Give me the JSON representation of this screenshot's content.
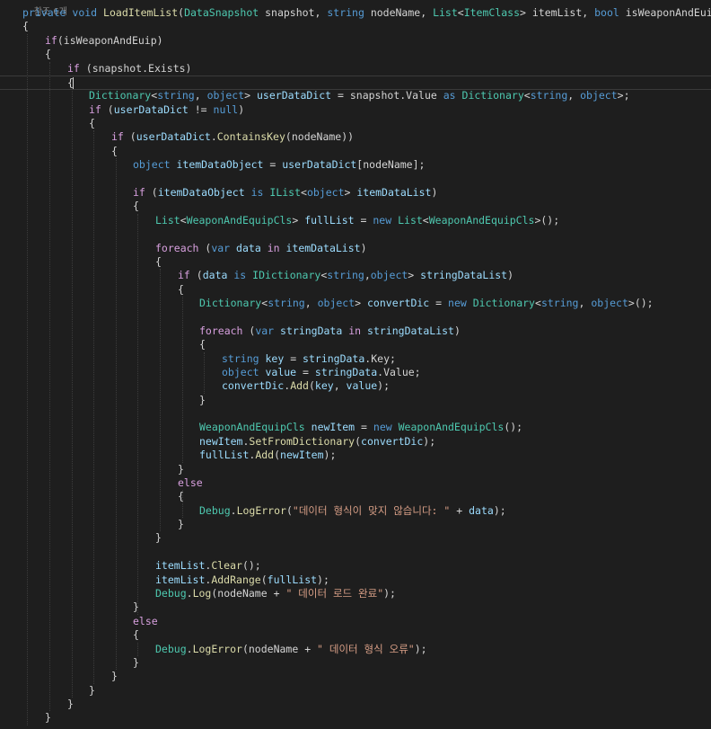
{
  "editor": {
    "language": "C#",
    "theme_colors": {
      "background": "#1e1e1e",
      "keyword": "#569cd6",
      "control": "#d8a0df",
      "type": "#4ec9b0",
      "method": "#dcdcaa",
      "variable": "#9cdcfe",
      "string": "#d69d85",
      "text": "#d4d4d4"
    },
    "codelens": "참조 6개",
    "lines": [
      [
        {
          "k": "kw",
          "t": "private"
        },
        {
          "k": "pun",
          "t": " "
        },
        {
          "k": "kw",
          "t": "void"
        },
        {
          "k": "pun",
          "t": " "
        },
        {
          "k": "method",
          "t": "LoadItemList"
        },
        {
          "k": "pun",
          "t": "("
        },
        {
          "k": "type",
          "t": "DataSnapshot"
        },
        {
          "k": "pun",
          "t": " snapshot, "
        },
        {
          "k": "kw",
          "t": "string"
        },
        {
          "k": "pun",
          "t": " nodeName, "
        },
        {
          "k": "type",
          "t": "List"
        },
        {
          "k": "pun",
          "t": "<"
        },
        {
          "k": "type",
          "t": "ItemClass"
        },
        {
          "k": "pun",
          "t": "> itemList, "
        },
        {
          "k": "kw",
          "t": "bool"
        },
        {
          "k": "pun",
          "t": " isWeaponAndEuip)"
        }
      ],
      [
        {
          "k": "pun",
          "t": "{"
        }
      ],
      [
        {
          "k": "ctl",
          "t": "if"
        },
        {
          "k": "pun",
          "t": "(isWeaponAndEuip)"
        }
      ],
      [
        {
          "k": "pun",
          "t": "{"
        }
      ],
      [
        {
          "k": "ctl",
          "t": "if"
        },
        {
          "k": "pun",
          "t": " (snapshot.Exists)"
        }
      ],
      [
        {
          "k": "pun",
          "t": "{"
        }
      ],
      [
        {
          "k": "type",
          "t": "Dictionary"
        },
        {
          "k": "pun",
          "t": "<"
        },
        {
          "k": "kw",
          "t": "string"
        },
        {
          "k": "pun",
          "t": ", "
        },
        {
          "k": "kw",
          "t": "object"
        },
        {
          "k": "pun",
          "t": "> "
        },
        {
          "k": "var",
          "t": "userDataDict"
        },
        {
          "k": "pun",
          "t": " = snapshot.Value "
        },
        {
          "k": "kw",
          "t": "as"
        },
        {
          "k": "pun",
          "t": " "
        },
        {
          "k": "type",
          "t": "Dictionary"
        },
        {
          "k": "pun",
          "t": "<"
        },
        {
          "k": "kw",
          "t": "string"
        },
        {
          "k": "pun",
          "t": ", "
        },
        {
          "k": "kw",
          "t": "object"
        },
        {
          "k": "pun",
          "t": ">;"
        }
      ],
      [
        {
          "k": "ctl",
          "t": "if"
        },
        {
          "k": "pun",
          "t": " ("
        },
        {
          "k": "var",
          "t": "userDataDict"
        },
        {
          "k": "pun",
          "t": " != "
        },
        {
          "k": "kw",
          "t": "null"
        },
        {
          "k": "pun",
          "t": ")"
        }
      ],
      [
        {
          "k": "pun",
          "t": "{"
        }
      ],
      [
        {
          "k": "ctl",
          "t": "if"
        },
        {
          "k": "pun",
          "t": " ("
        },
        {
          "k": "var",
          "t": "userDataDict"
        },
        {
          "k": "pun",
          "t": "."
        },
        {
          "k": "method",
          "t": "ContainsKey"
        },
        {
          "k": "pun",
          "t": "(nodeName))"
        }
      ],
      [
        {
          "k": "pun",
          "t": "{"
        }
      ],
      [
        {
          "k": "kw",
          "t": "object"
        },
        {
          "k": "pun",
          "t": " "
        },
        {
          "k": "var",
          "t": "itemDataObject"
        },
        {
          "k": "pun",
          "t": " = "
        },
        {
          "k": "var",
          "t": "userDataDict"
        },
        {
          "k": "pun",
          "t": "[nodeName];"
        }
      ],
      [],
      [
        {
          "k": "ctl",
          "t": "if"
        },
        {
          "k": "pun",
          "t": " ("
        },
        {
          "k": "var",
          "t": "itemDataObject"
        },
        {
          "k": "pun",
          "t": " "
        },
        {
          "k": "kw",
          "t": "is"
        },
        {
          "k": "pun",
          "t": " "
        },
        {
          "k": "type",
          "t": "IList"
        },
        {
          "k": "pun",
          "t": "<"
        },
        {
          "k": "kw",
          "t": "object"
        },
        {
          "k": "pun",
          "t": "> "
        },
        {
          "k": "var",
          "t": "itemDataList"
        },
        {
          "k": "pun",
          "t": ")"
        }
      ],
      [
        {
          "k": "pun",
          "t": "{"
        }
      ],
      [
        {
          "k": "type",
          "t": "List"
        },
        {
          "k": "pun",
          "t": "<"
        },
        {
          "k": "type",
          "t": "WeaponAndEquipCls"
        },
        {
          "k": "pun",
          "t": "> "
        },
        {
          "k": "var",
          "t": "fullList"
        },
        {
          "k": "pun",
          "t": " = "
        },
        {
          "k": "kw",
          "t": "new"
        },
        {
          "k": "pun",
          "t": " "
        },
        {
          "k": "type",
          "t": "List"
        },
        {
          "k": "pun",
          "t": "<"
        },
        {
          "k": "type",
          "t": "WeaponAndEquipCls"
        },
        {
          "k": "pun",
          "t": ">();"
        }
      ],
      [],
      [
        {
          "k": "ctl",
          "t": "foreach"
        },
        {
          "k": "pun",
          "t": " ("
        },
        {
          "k": "kw",
          "t": "var"
        },
        {
          "k": "pun",
          "t": " "
        },
        {
          "k": "var",
          "t": "data"
        },
        {
          "k": "pun",
          "t": " "
        },
        {
          "k": "ctl",
          "t": "in"
        },
        {
          "k": "pun",
          "t": " "
        },
        {
          "k": "var",
          "t": "itemDataList"
        },
        {
          "k": "pun",
          "t": ")"
        }
      ],
      [
        {
          "k": "pun",
          "t": "{"
        }
      ],
      [
        {
          "k": "ctl",
          "t": "if"
        },
        {
          "k": "pun",
          "t": " ("
        },
        {
          "k": "var",
          "t": "data"
        },
        {
          "k": "pun",
          "t": " "
        },
        {
          "k": "kw",
          "t": "is"
        },
        {
          "k": "pun",
          "t": " "
        },
        {
          "k": "type",
          "t": "IDictionary"
        },
        {
          "k": "pun",
          "t": "<"
        },
        {
          "k": "kw",
          "t": "string"
        },
        {
          "k": "pun",
          "t": ","
        },
        {
          "k": "kw",
          "t": "object"
        },
        {
          "k": "pun",
          "t": "> "
        },
        {
          "k": "var",
          "t": "stringDataList"
        },
        {
          "k": "pun",
          "t": ")"
        }
      ],
      [
        {
          "k": "pun",
          "t": "{"
        }
      ],
      [
        {
          "k": "type",
          "t": "Dictionary"
        },
        {
          "k": "pun",
          "t": "<"
        },
        {
          "k": "kw",
          "t": "string"
        },
        {
          "k": "pun",
          "t": ", "
        },
        {
          "k": "kw",
          "t": "object"
        },
        {
          "k": "pun",
          "t": "> "
        },
        {
          "k": "var",
          "t": "convertDic"
        },
        {
          "k": "pun",
          "t": " = "
        },
        {
          "k": "kw",
          "t": "new"
        },
        {
          "k": "pun",
          "t": " "
        },
        {
          "k": "type",
          "t": "Dictionary"
        },
        {
          "k": "pun",
          "t": "<"
        },
        {
          "k": "kw",
          "t": "string"
        },
        {
          "k": "pun",
          "t": ", "
        },
        {
          "k": "kw",
          "t": "object"
        },
        {
          "k": "pun",
          "t": ">();"
        }
      ],
      [],
      [
        {
          "k": "ctl",
          "t": "foreach"
        },
        {
          "k": "pun",
          "t": " ("
        },
        {
          "k": "kw",
          "t": "var"
        },
        {
          "k": "pun",
          "t": " "
        },
        {
          "k": "var",
          "t": "stringData"
        },
        {
          "k": "pun",
          "t": " "
        },
        {
          "k": "ctl",
          "t": "in"
        },
        {
          "k": "pun",
          "t": " "
        },
        {
          "k": "var",
          "t": "stringDataList"
        },
        {
          "k": "pun",
          "t": ")"
        }
      ],
      [
        {
          "k": "pun",
          "t": "{"
        }
      ],
      [
        {
          "k": "kw",
          "t": "string"
        },
        {
          "k": "pun",
          "t": " "
        },
        {
          "k": "var",
          "t": "key"
        },
        {
          "k": "pun",
          "t": " = "
        },
        {
          "k": "var",
          "t": "stringData"
        },
        {
          "k": "pun",
          "t": ".Key;"
        }
      ],
      [
        {
          "k": "kw",
          "t": "object"
        },
        {
          "k": "pun",
          "t": " "
        },
        {
          "k": "var",
          "t": "value"
        },
        {
          "k": "pun",
          "t": " = "
        },
        {
          "k": "var",
          "t": "stringData"
        },
        {
          "k": "pun",
          "t": ".Value;"
        }
      ],
      [
        {
          "k": "var",
          "t": "convertDic"
        },
        {
          "k": "pun",
          "t": "."
        },
        {
          "k": "method",
          "t": "Add"
        },
        {
          "k": "pun",
          "t": "("
        },
        {
          "k": "var",
          "t": "key"
        },
        {
          "k": "pun",
          "t": ", "
        },
        {
          "k": "var",
          "t": "value"
        },
        {
          "k": "pun",
          "t": ");"
        }
      ],
      [
        {
          "k": "pun",
          "t": "}"
        }
      ],
      [],
      [
        {
          "k": "type",
          "t": "WeaponAndEquipCls"
        },
        {
          "k": "pun",
          "t": " "
        },
        {
          "k": "var",
          "t": "newItem"
        },
        {
          "k": "pun",
          "t": " = "
        },
        {
          "k": "kw",
          "t": "new"
        },
        {
          "k": "pun",
          "t": " "
        },
        {
          "k": "type",
          "t": "WeaponAndEquipCls"
        },
        {
          "k": "pun",
          "t": "();"
        }
      ],
      [
        {
          "k": "var",
          "t": "newItem"
        },
        {
          "k": "pun",
          "t": "."
        },
        {
          "k": "method",
          "t": "SetFromDictionary"
        },
        {
          "k": "pun",
          "t": "("
        },
        {
          "k": "var",
          "t": "convertDic"
        },
        {
          "k": "pun",
          "t": ");"
        }
      ],
      [
        {
          "k": "var",
          "t": "fullList"
        },
        {
          "k": "pun",
          "t": "."
        },
        {
          "k": "method",
          "t": "Add"
        },
        {
          "k": "pun",
          "t": "("
        },
        {
          "k": "var",
          "t": "newItem"
        },
        {
          "k": "pun",
          "t": ");"
        }
      ],
      [
        {
          "k": "pun",
          "t": "}"
        }
      ],
      [
        {
          "k": "ctl",
          "t": "else"
        }
      ],
      [
        {
          "k": "pun",
          "t": "{"
        }
      ],
      [
        {
          "k": "type",
          "t": "Debug"
        },
        {
          "k": "pun",
          "t": "."
        },
        {
          "k": "method",
          "t": "LogError"
        },
        {
          "k": "pun",
          "t": "("
        },
        {
          "k": "str",
          "t": "\"데이터 형식이 맞지 않습니다: \""
        },
        {
          "k": "pun",
          "t": " + "
        },
        {
          "k": "var",
          "t": "data"
        },
        {
          "k": "pun",
          "t": ");"
        }
      ],
      [
        {
          "k": "pun",
          "t": "}"
        }
      ],
      [
        {
          "k": "pun",
          "t": "}"
        }
      ],
      [],
      [
        {
          "k": "var",
          "t": "itemList"
        },
        {
          "k": "pun",
          "t": "."
        },
        {
          "k": "method",
          "t": "Clear"
        },
        {
          "k": "pun",
          "t": "();"
        }
      ],
      [
        {
          "k": "var",
          "t": "itemList"
        },
        {
          "k": "pun",
          "t": "."
        },
        {
          "k": "method",
          "t": "AddRange"
        },
        {
          "k": "pun",
          "t": "("
        },
        {
          "k": "var",
          "t": "fullList"
        },
        {
          "k": "pun",
          "t": ");"
        }
      ],
      [
        {
          "k": "type",
          "t": "Debug"
        },
        {
          "k": "pun",
          "t": "."
        },
        {
          "k": "method",
          "t": "Log"
        },
        {
          "k": "pun",
          "t": "(nodeName + "
        },
        {
          "k": "str",
          "t": "\" 데이터 로드 완료\""
        },
        {
          "k": "pun",
          "t": ");"
        }
      ],
      [
        {
          "k": "pun",
          "t": "}"
        }
      ],
      [
        {
          "k": "ctl",
          "t": "else"
        }
      ],
      [
        {
          "k": "pun",
          "t": "{"
        }
      ],
      [
        {
          "k": "type",
          "t": "Debug"
        },
        {
          "k": "pun",
          "t": "."
        },
        {
          "k": "method",
          "t": "LogError"
        },
        {
          "k": "pun",
          "t": "(nodeName + "
        },
        {
          "k": "str",
          "t": "\" 데이터 형식 오류\""
        },
        {
          "k": "pun",
          "t": ");"
        }
      ],
      [
        {
          "k": "pun",
          "t": "}"
        }
      ],
      [
        {
          "k": "pun",
          "t": "}"
        }
      ],
      [
        {
          "k": "pun",
          "t": "}"
        }
      ],
      [
        {
          "k": "pun",
          "t": "}"
        }
      ],
      [
        {
          "k": "pun",
          "t": "}"
        }
      ]
    ]
  }
}
